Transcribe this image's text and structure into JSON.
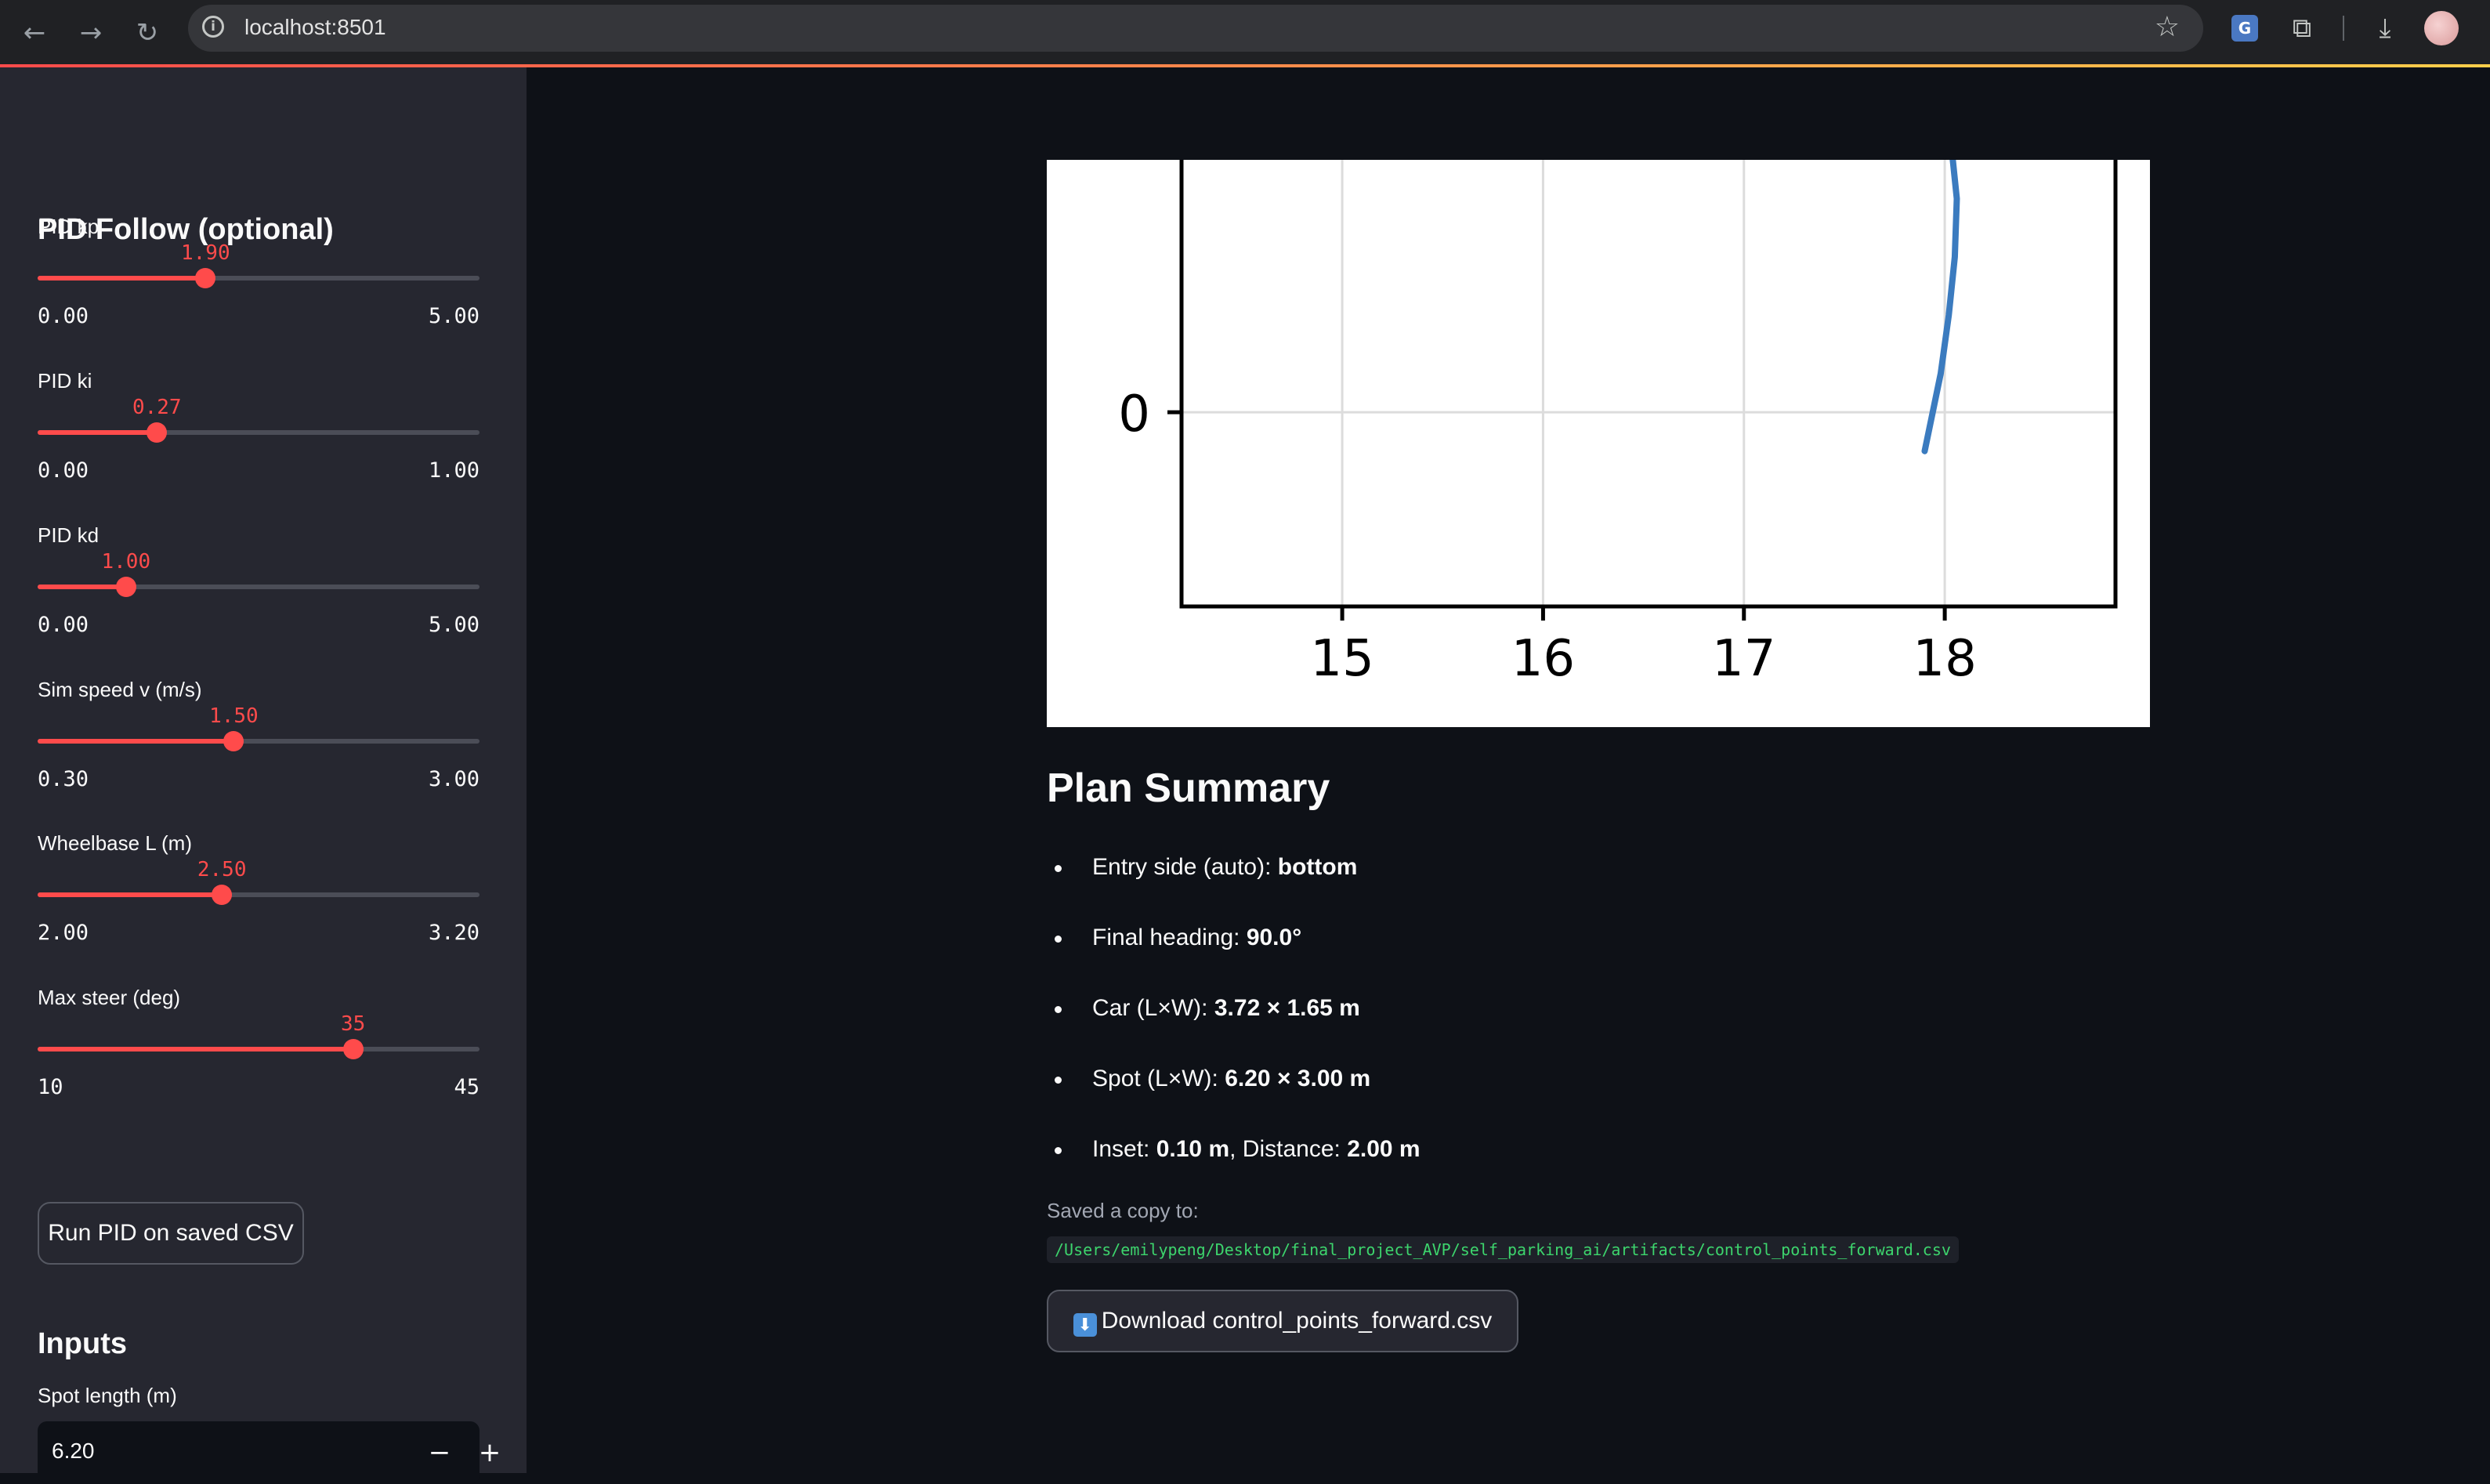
{
  "browser": {
    "url": "localhost:8501",
    "icons": [
      "back-icon",
      "forward-icon",
      "reload-icon",
      "site-info-icon",
      "bookmark-star-icon",
      "translate-icon",
      "extensions-icon",
      "downloads-icon",
      "profile-avatar"
    ]
  },
  "colors": {
    "accent": "#ff4b4b",
    "background": "#0e1117",
    "sidebar": "#262730",
    "plot_line": "#3b7bbf",
    "code_text": "#3dd56d"
  },
  "sidebar": {
    "pid_heading": "PID Follow (optional)",
    "sliders": [
      {
        "label": "PID kp",
        "value": "1.90",
        "min": "0.00",
        "max": "5.00",
        "fraction": 0.38
      },
      {
        "label": "PID ki",
        "value": "0.27",
        "min": "0.00",
        "max": "1.00",
        "fraction": 0.27
      },
      {
        "label": "PID kd",
        "value": "1.00",
        "min": "0.00",
        "max": "5.00",
        "fraction": 0.2
      },
      {
        "label": "Sim speed v (m/s)",
        "value": "1.50",
        "min": "0.30",
        "max": "3.00",
        "fraction": 0.444
      },
      {
        "label": "Wheelbase L (m)",
        "value": "2.50",
        "min": "2.00",
        "max": "3.20",
        "fraction": 0.417
      },
      {
        "label": "Max steer (deg)",
        "value": "35",
        "min": "10",
        "max": "45",
        "fraction": 0.714
      }
    ],
    "run_button": "Run PID on saved CSV",
    "inputs_heading": "Inputs",
    "spot_length_label": "Spot length (m)",
    "spot_length_value": "6.20",
    "minus": "−",
    "plus": "+"
  },
  "chart_data": {
    "type": "line",
    "x_ticks": [
      "15",
      "16",
      "17",
      "18"
    ],
    "y_ticks": [
      "0"
    ],
    "xlim": [
      14.2,
      18.85
    ],
    "ylim": [
      -1.0,
      1.3
    ],
    "grid": true,
    "series": [
      {
        "x": [
          17.9,
          17.94,
          17.98,
          18.02,
          18.05,
          18.06,
          18.04
        ],
        "y": [
          -0.2,
          0.0,
          0.2,
          0.5,
          0.8,
          1.1,
          1.3
        ]
      }
    ]
  },
  "main": {
    "summary_title": "Plan Summary",
    "bullets": [
      {
        "label": "Entry side (auto): ",
        "value": "bottom"
      },
      {
        "label": "Final heading: ",
        "value": "90.0°"
      },
      {
        "label": "Car (L×W): ",
        "value": "3.72 × 1.65 m"
      },
      {
        "label": "Spot (L×W): ",
        "value": "6.20 × 3.00 m"
      }
    ],
    "inset_label": "Inset: ",
    "inset_value": "0.10 m",
    "distance_label": ", Distance: ",
    "distance_value": "2.00 m",
    "saved_caption": "Saved a copy to:",
    "saved_path": "/Users/emilypeng/Desktop/final_project_AVP/self_parking_ai/artifacts/control_points_forward.csv",
    "download_button": "Download control_points_forward.csv"
  }
}
